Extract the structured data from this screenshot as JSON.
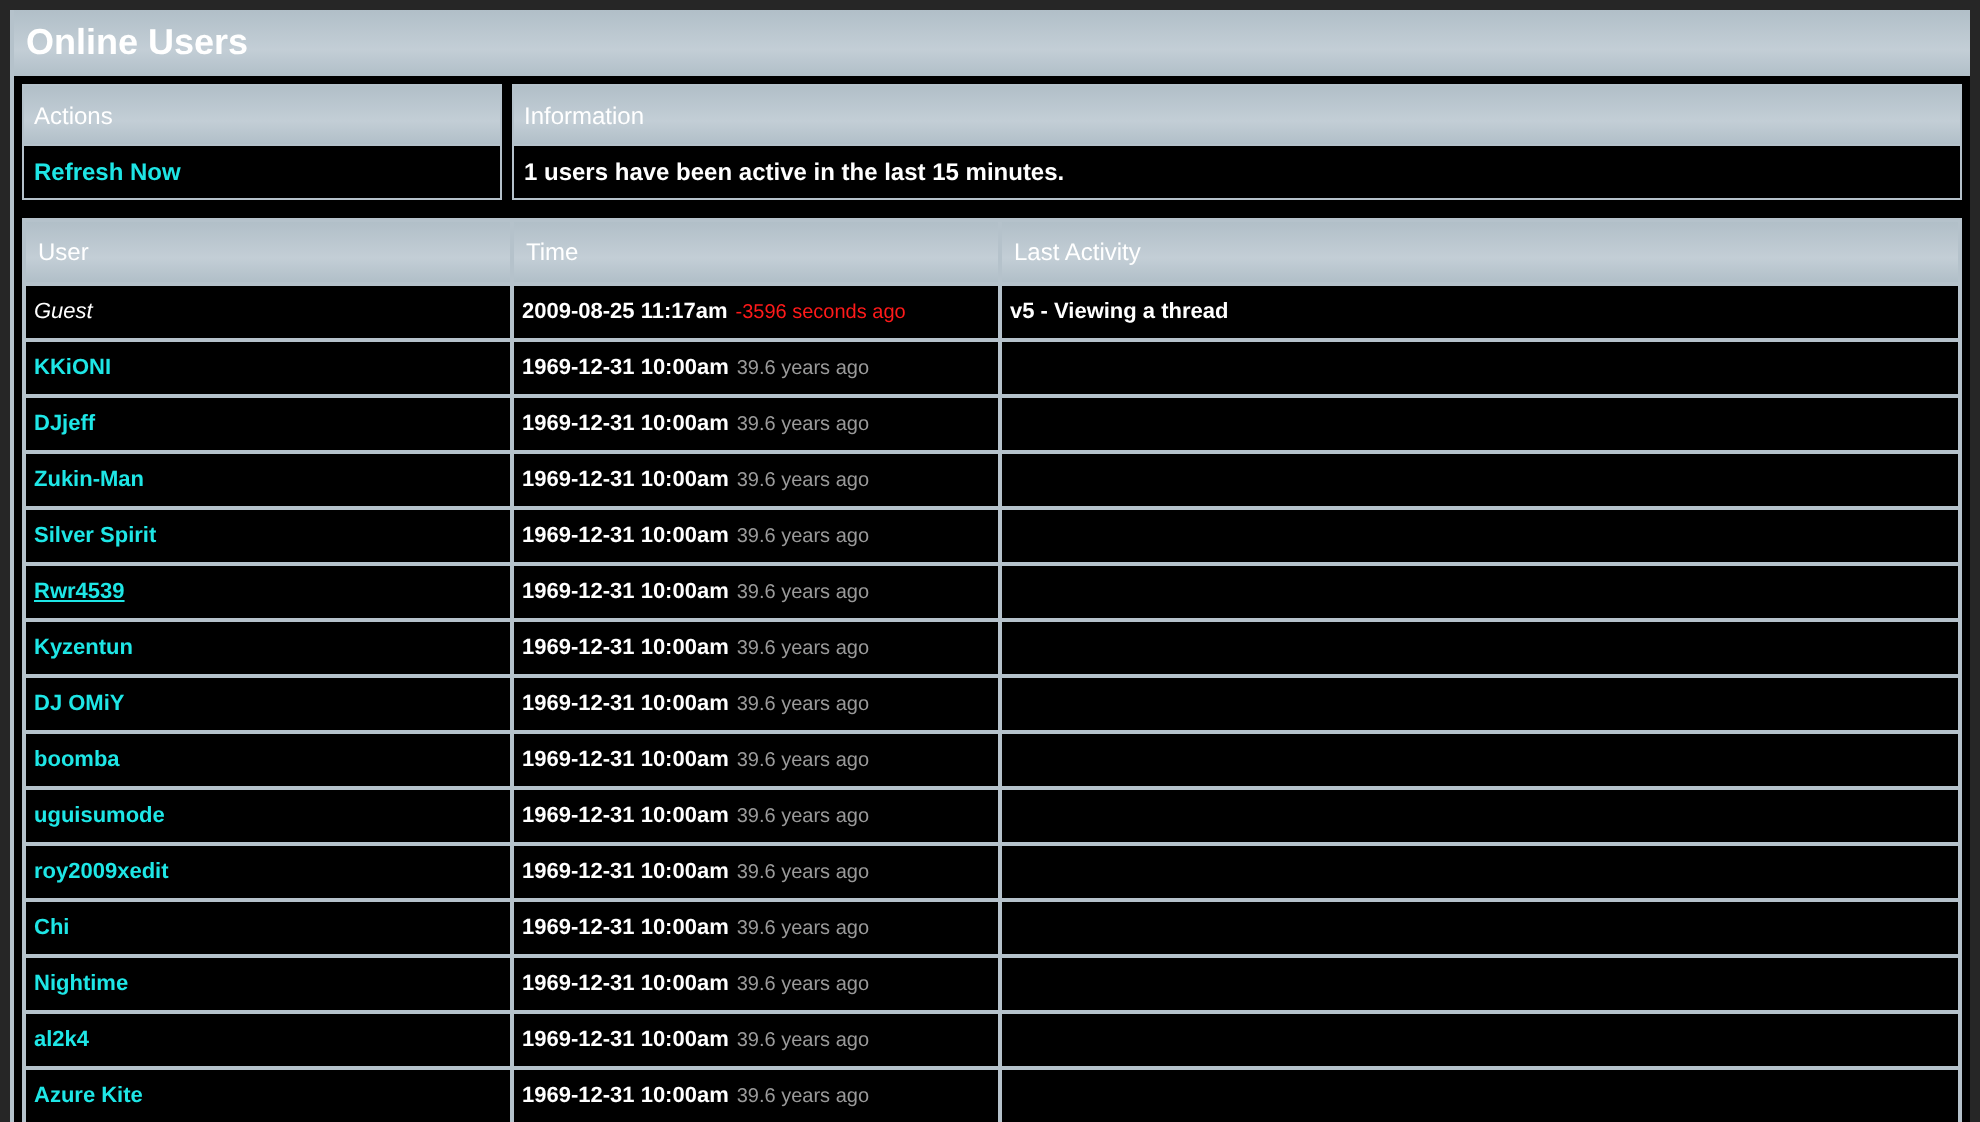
{
  "title": "Online Users",
  "actions": {
    "heading": "Actions",
    "link": "Refresh Now"
  },
  "information": {
    "heading": "Information",
    "text": "1 users have been active in the last 15 minutes."
  },
  "table": {
    "columns": [
      "User",
      "Time",
      "Last Activity"
    ],
    "rows": [
      {
        "user": "Guest",
        "kind": "guest",
        "hovered": false,
        "time": "2009-08-25 11:17am",
        "ago": "-3596 seconds ago",
        "warning": true,
        "activity": "v5 - Viewing a thread"
      },
      {
        "user": "KKiONI",
        "kind": "member",
        "hovered": false,
        "time": "1969-12-31 10:00am",
        "ago": "39.6 years ago",
        "warning": false
      },
      {
        "user": "DJjeff",
        "kind": "member",
        "hovered": false,
        "time": "1969-12-31 10:00am",
        "ago": "39.6 years ago",
        "warning": false
      },
      {
        "user": "Zukin-Man",
        "kind": "member",
        "hovered": false,
        "time": "1969-12-31 10:00am",
        "ago": "39.6 years ago",
        "warning": false
      },
      {
        "user": "Silver Spirit",
        "kind": "member",
        "hovered": false,
        "time": "1969-12-31 10:00am",
        "ago": "39.6 years ago",
        "warning": false
      },
      {
        "user": "Rwr4539",
        "kind": "member",
        "hovered": true,
        "time": "1969-12-31 10:00am",
        "ago": "39.6 years ago",
        "warning": false
      },
      {
        "user": "Kyzentun",
        "kind": "member",
        "hovered": false,
        "time": "1969-12-31 10:00am",
        "ago": "39.6 years ago",
        "warning": false
      },
      {
        "user": "DJ OMiY",
        "kind": "member",
        "hovered": false,
        "time": "1969-12-31 10:00am",
        "ago": "39.6 years ago",
        "warning": false
      },
      {
        "user": "boomba",
        "kind": "member",
        "hovered": false,
        "time": "1969-12-31 10:00am",
        "ago": "39.6 years ago",
        "warning": false
      },
      {
        "user": "uguisumode",
        "kind": "member",
        "hovered": false,
        "time": "1969-12-31 10:00am",
        "ago": "39.6 years ago",
        "warning": false
      },
      {
        "user": "roy2009xedit",
        "kind": "member",
        "hovered": false,
        "time": "1969-12-31 10:00am",
        "ago": "39.6 years ago",
        "warning": false
      },
      {
        "user": "Chi",
        "kind": "member",
        "hovered": false,
        "time": "1969-12-31 10:00am",
        "ago": "39.6 years ago",
        "warning": false
      },
      {
        "user": "Nightime",
        "kind": "member",
        "hovered": false,
        "time": "1969-12-31 10:00am",
        "ago": "39.6 years ago",
        "warning": false
      },
      {
        "user": "al2k4",
        "kind": "member",
        "hovered": false,
        "time": "1969-12-31 10:00am",
        "ago": "39.6 years ago",
        "warning": false
      },
      {
        "user": "Azure Kite",
        "kind": "member",
        "hovered": false,
        "time": "1969-12-31 10:00am",
        "ago": "39.6 years ago",
        "warning": false
      }
    ]
  }
}
